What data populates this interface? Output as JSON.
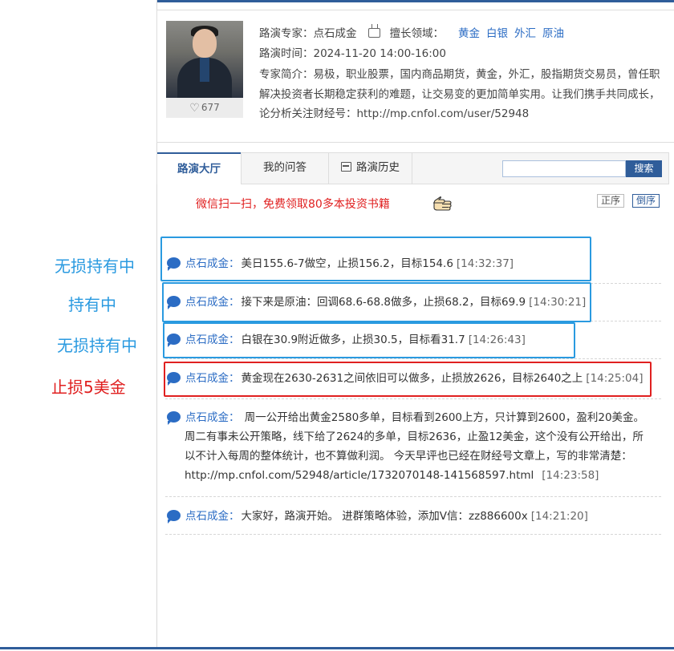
{
  "expert": {
    "name_line_label": "路演专家：",
    "name": "点石成金",
    "field_label": "擅长领域：",
    "fields": [
      "黄金",
      "白银",
      "外汇",
      "原油"
    ],
    "time_label": "路演时间：",
    "time": "2024-11-20 14:00-16:00",
    "intro_line1": "专家简介：易极，职业股票，国内商品期货，黄金，外汇，股指期货交易员，曾任职",
    "intro_line2": "解决投资者长期稳定获利的难题，让交易变的更加简单实用。让我们携手共同成长，",
    "intro_line3": "论分析关注财经号：http://mp.cnfol.com/user/52948",
    "likes": "677"
  },
  "tabs": {
    "hall": "路演大厅",
    "qa": "我的问答",
    "history": "路演历史"
  },
  "search": {
    "button": "搜索",
    "placeholder": ""
  },
  "promo": "微信扫一扫，免费领取80多本投资书籍",
  "sort": {
    "asc": "正序",
    "desc": "倒序"
  },
  "messages": [
    {
      "author": "点石成金：",
      "text": "美日155.6-7做空，止损156.2，目标154.6",
      "time": "[14:32:37]"
    },
    {
      "author": "点石成金：",
      "text": "接下来是原油：回调68.6-68.8做多，止损68.2，目标69.9",
      "time": "[14:30:21]"
    },
    {
      "author": "点石成金：",
      "text": "白银在30.9附近做多，止损30.5，目标看31.7",
      "time": "[14:26:43]"
    },
    {
      "author": "点石成金：",
      "text": "黄金现在2630-2631之间依旧可以做多，止损放2626，目标2640之上",
      "time": "[14:25:04]"
    },
    {
      "author": "点石成金：",
      "lines": [
        "周一公开给出黄金2580多单，目标看到2600上方，只计算到2600，盈利20美金。",
        "周二有事未公开策略，线下给了2624的多单，目标2636，止盈12美金，这个没有公开给出，所",
        "以不计入每周的整体统计，也不算做利润。 今天早评也已经在财经号文章上，写的非常清楚：",
        "http://mp.cnfol.com/52948/article/1732070148-141568597.html"
      ],
      "time": "[14:23:58]"
    },
    {
      "author": "点石成金：",
      "text": "大家好，路演开始。 进群策略体验，添加V信：zz886600x",
      "time": "[14:21:20]"
    }
  ],
  "annotations": [
    {
      "label": "无损持有中",
      "color": "#2a9ae0"
    },
    {
      "label": "持有中",
      "color": "#2a9ae0"
    },
    {
      "label": "无损持有中",
      "color": "#2a9ae0"
    },
    {
      "label": "止损5美金",
      "color": "#e02020"
    }
  ],
  "colors": {
    "brand": "#2f5d9a",
    "link": "#2b6cc4",
    "alert": "#e02020",
    "annotation_blue": "#2a9ae0"
  },
  "icons": [
    "heart-icon",
    "tv-icon",
    "calendar-icon",
    "chat-bubble-icon",
    "pointing-hand-icon"
  ]
}
